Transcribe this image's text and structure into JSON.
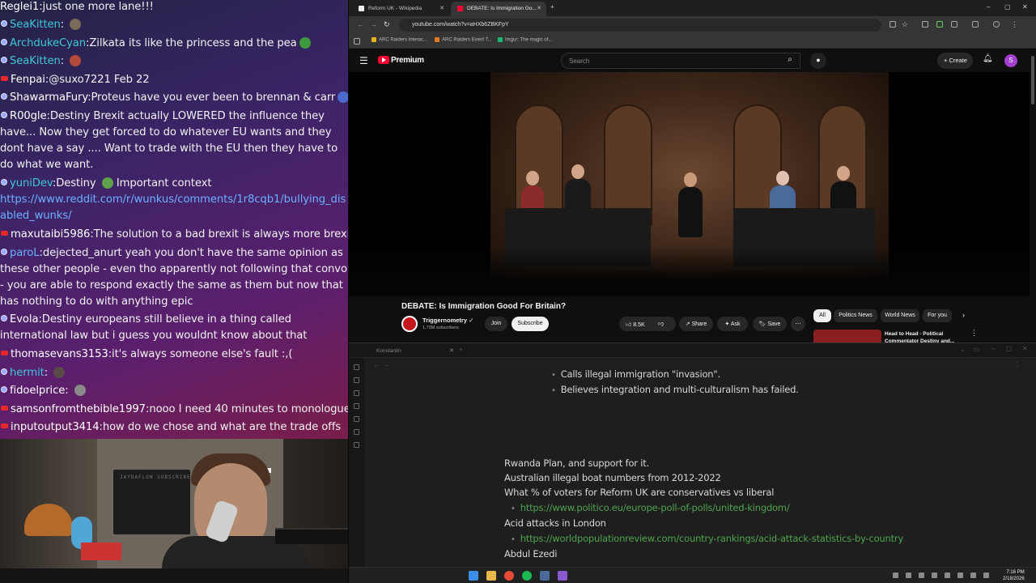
{
  "chat": {
    "messages": [
      {
        "user": "Reglei1",
        "text": "just one more lane!!!",
        "user_color": "#ffffff"
      },
      {
        "user": "SeaKitten",
        "text": "",
        "user_color": "#3ec7d8"
      },
      {
        "user": "ArchdukeCyan",
        "text": "Zilkata its like the princess and the pea",
        "user_color": "#3ec7d8"
      },
      {
        "user": "SeaKitten",
        "text": "",
        "user_color": "#3ec7d8"
      },
      {
        "user": "Fenpai",
        "text": "@suxo7221 Feb 22",
        "user_color": "#ffffff"
      },
      {
        "user": "ShawarmaFury",
        "text": "Proteus have you ever been to brennan & carr",
        "user_color": "#ffffff"
      },
      {
        "user": "R00gle",
        "text": "Destiny Brexit actually LOWERED the influence they have... Now they get forced to do whatever EU wants and they dont have a say .... Want to trade with the EU then they have to do what we want.",
        "user_color": "#ffffff"
      },
      {
        "user": "yuniDev",
        "text": "Destiny",
        "text2": "Important context",
        "user_color": "#3ec7d8"
      },
      {
        "user": "",
        "text": "https://www.reddit.com/r/wunkus/comments/1r8cqb1/bullying_disabled_wunks/",
        "user_color": "#ffffff"
      },
      {
        "user": "maxutaibi5986",
        "text": "The solution to a bad brexit is always more brexit",
        "user_color": "#ffffff"
      },
      {
        "user": "paroL",
        "text": "dejected_anurt yeah you don't have the same opinion as these other people - even tho apparently not following that convo - you are able to respond exactly the same as them but now that has nothing to do with anything epic",
        "user_color": "#6bb0ff"
      },
      {
        "user": "Evola",
        "text": "Destiny europeans still believe in a thing called international law but i guess you wouldnt know about that",
        "user_color": "#ffffff"
      },
      {
        "user": "thomasevans3153",
        "text": "it's always someone else's fault :,(",
        "user_color": "#ffffff"
      },
      {
        "user": "hermit",
        "text": "",
        "user_color": "#3ec7d8"
      },
      {
        "user": "fidoelprice",
        "text": "",
        "user_color": "#ffffff"
      },
      {
        "user": "samsonfromthebible1997",
        "text": "nooo I need 40 minutes to monologue",
        "user_color": "#ffffff"
      },
      {
        "user": "inputoutput3414",
        "text": "how do we chose and what are the trade offs",
        "user_color": "#ffffff"
      }
    ]
  },
  "webcam": {
    "speaker_label": "JAYDAFLOW SUBSCRIBE"
  },
  "browser": {
    "tabs": [
      {
        "title": "Reform UK - Wikipedia",
        "favicon": "W"
      },
      {
        "title": "DEBATE: Is Immigration Go...",
        "favicon": "yt"
      }
    ],
    "url": "youtube.com/watch?v=aHXb6ZBKFpY",
    "bookmarks": [
      "ARC Raiders Interac...",
      "ARC Raiders Event T...",
      "Imgur: The magic of..."
    ]
  },
  "youtube": {
    "brand": "Premium",
    "search_placeholder": "Search",
    "create_label": "Create",
    "avatar_letter": "S",
    "video_title": "DEBATE: Is Immigration Good For Britain?",
    "channel_name": "Triggernometry",
    "channel_subs": "1.73M subscribers",
    "join_label": "Join",
    "subscribe_label": "Subscribe",
    "like_count": "8.5K",
    "share_label": "Share",
    "ask_label": "Ask",
    "save_label": "Save",
    "chips": [
      "All",
      "Politics News",
      "World News",
      "For you"
    ],
    "rec_title": "Head to Head - Political Commentator Destiny and..."
  },
  "notes": {
    "tab_title": "Konstantin",
    "bullets_top": [
      "Calls illegal immigration \"invasion\".",
      "Believes integration and multi-culturalism has failed."
    ],
    "lines": [
      {
        "text": "Rwanda Plan, and support for it."
      },
      {
        "text": "Australian illegal boat numbers from 2012-2022"
      },
      {
        "text": "What % of voters for Reform UK are conservatives vs liberal"
      },
      {
        "link": "https://www.politico.eu/europe-poll-of-polls/united-kingdom/"
      },
      {
        "text": "Acid attacks in London"
      },
      {
        "link": "https://worldpopulationreview.com/country-rankings/acid-attack-statistics-by-country"
      },
      {
        "text": "Abdul Ezedi"
      }
    ]
  },
  "taskbar": {
    "time": "7:16 PM",
    "date": "2/18/2026"
  }
}
